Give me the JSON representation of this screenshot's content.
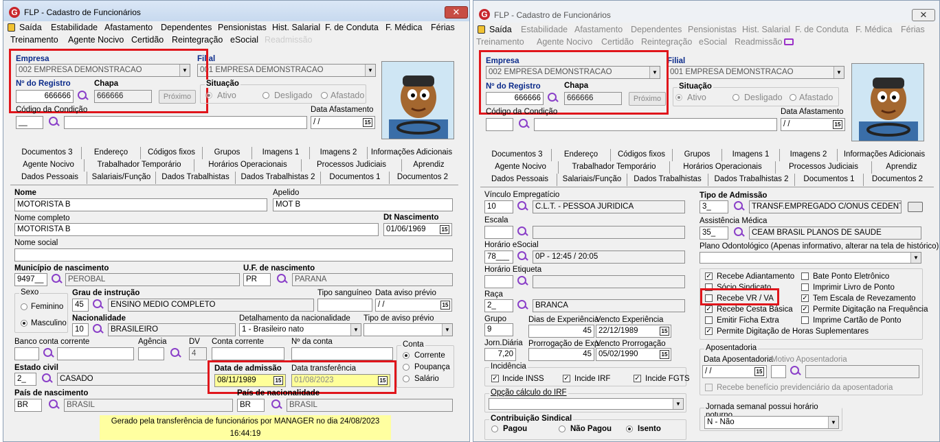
{
  "left": {
    "title": "FLP - Cadastro de Funcionários",
    "close": "✕",
    "menu1": [
      "Saída",
      "Estabilidade",
      "Afastamento",
      "Dependentes",
      "Pensionistas",
      "Hist. Salarial",
      "F. de Conduta",
      "F. Médica",
      "Férias"
    ],
    "menu2": [
      "Treinamento",
      "Agente Nocivo",
      "Certidão",
      "Reintegração",
      "eSocial",
      "Readmissão"
    ],
    "empresa_label": "Empresa",
    "empresa_value": "002 EMPRESA DEMONSTRACAO",
    "filial_label": "Filial",
    "filial_value": "001 EMPRESA DEMONSTRACAO",
    "nreg_label": "Nº do Registro",
    "nreg_value": "666666",
    "chapa_label": "Chapa",
    "chapa_value": "666666",
    "proximo": "Próximo",
    "situacao": "Situação",
    "ativo": "Ativo",
    "desligado": "Desligado",
    "afastado": "Afastado",
    "cond_label": "Código da Condição",
    "cond_value": "__",
    "dtafast_label": "Data Afastamento",
    "dtafast_value": " / /",
    "tabs1": [
      "Documentos 3",
      "Endereço",
      "Códigos fixos",
      "Grupos",
      "Imagens 1",
      "Imagens 2",
      "Informações Adicionais"
    ],
    "tabs2": [
      "Agente Nocivo",
      "Trabalhador Temporário",
      "Horários Operacionais",
      "Processos Judiciais",
      "Aprendiz"
    ],
    "tabs3": [
      "Dados Pessoais",
      "Salariais/Função",
      "Dados Trabalhistas",
      "Dados Trabalhistas 2",
      "Documentos 1",
      "Documentos 2"
    ],
    "nome_label": "Nome",
    "nome_value": "MOTORISTA B",
    "apelido_label": "Apelido",
    "apelido_value": "MOT B",
    "nomecomp_label": "Nome completo",
    "nomecomp_value": "MOTORISTA B",
    "dtnasc_label": "Dt Nascimento",
    "dtnasc_value": "01/06/1969",
    "nomesoc_label": "Nome social",
    "nomesoc_value": "",
    "munic_label": "Município de nascimento",
    "munic_code": "9497__",
    "munic_value": "PEROBAL",
    "uf_label": "U.F. de nascimento",
    "uf_code": "PR",
    "uf_value": "PARANA",
    "sexo": "Sexo",
    "feminino": "Feminino",
    "masculino": "Masculino",
    "grau_label": "Grau de instrução",
    "grau_code": "45",
    "grau_value": "ENSINO MEDIO COMPLETO",
    "sangue_label": "Tipo sanguíneo",
    "avisoprev_label": "Data aviso prévio",
    "avisoprev_value": " / /",
    "nac_label": "Nacionalidade",
    "nac_code": "10",
    "nac_value": "BRASILEIRO",
    "detnac_label": "Detalhamento da nacionalidade",
    "detnac_value": "1 - Brasileiro nato",
    "tipoaviso_label": "Tipo de aviso prévio",
    "banco_label": "Banco conta corrente",
    "agencia_label": "Agência",
    "dv_label": "DV",
    "dv_value": "4",
    "conta_label": "Conta corrente",
    "nconta_label": "Nº da conta",
    "contagrp": "Conta",
    "corrente": "Corrente",
    "poupanca": "Poupança",
    "salario": "Salário",
    "estciv_label": "Estado civil",
    "estciv_code": "2_",
    "estciv_value": "CASADO",
    "dtadm_label": "Data de admissão",
    "dtadm_value": "08/11/1989",
    "dttransf_label": "Data transferência",
    "dttransf_value": "01/08/2023",
    "pais_label": "País de nascimento",
    "pais_code": "BR",
    "pais_value": "BRASIL",
    "paisnac_label": "País de nacionalidade",
    "paisnac_code": "BR",
    "paisnac_value": "BRASIL",
    "note": "Gerado pela transferência de funcionários por MANAGER no dia 24/08/2023 16:44:19"
  },
  "right": {
    "title": "FLP - Cadastro de Funcionários",
    "close": "✕",
    "menu1": [
      "Saída",
      "Estabilidade",
      "Afastamento",
      "Dependentes",
      "Pensionistas",
      "Hist. Salarial",
      "F. de Conduta",
      "F. Médica",
      "Férias"
    ],
    "menu2": [
      "Treinamento",
      "Agente Nocivo",
      "Certidão",
      "Reintegração",
      "eSocial",
      "Readmissão"
    ],
    "empresa_label": "Empresa",
    "empresa_value": "002 EMPRESA DEMONSTRACAO",
    "filial_label": "Filial",
    "filial_value": "001 EMPRESA DEMONSTRACAO",
    "nreg_label": "Nº do Registro",
    "nreg_value": "666666",
    "chapa_label": "Chapa",
    "chapa_value": "666666",
    "proximo": "Próximo",
    "situacao": "Situação",
    "ativo": "Ativo",
    "desligado": "Desligado",
    "afastado": "Afastado",
    "cond_label": "Código da Condição",
    "dtafast_label": "Data Afastamento",
    "dtafast_value": " / /",
    "tabs1": [
      "Documentos 3",
      "Endereço",
      "Códigos fixos",
      "Grupos",
      "Imagens 1",
      "Imagens 2",
      "Informações Adicionais"
    ],
    "tabs2": [
      "Agente Nocivo",
      "Trabalhador Temporário",
      "Horários Operacionais",
      "Processos Judiciais",
      "Aprendiz"
    ],
    "tabs3": [
      "Dados Pessoais",
      "Salariais/Função",
      "Dados Trabalhistas",
      "Dados Trabalhistas 2",
      "Documentos 1",
      "Documentos 2"
    ],
    "vinc_label": "Vínculo Empregatício",
    "vinc_code": "10",
    "vinc_value": "C.L.T. - PESSOA JURIDICA",
    "escala_label": "Escala",
    "horario_label": "Horário eSocial",
    "horario_code": "78___",
    "horario_value": "0P - 12:45 / 20:05",
    "etiqueta_label": "Horário Etiqueta",
    "raca_label": "Raça",
    "raca_code": "2_",
    "raca_value": "BRANCA",
    "grupo_label": "Grupo",
    "grupo_value": "9",
    "diasexp_label": "Dias de Experiência",
    "diasexp_value": "45",
    "vencexp_label": "Vencto Experiência",
    "vencexp_value": "22/12/1989",
    "jorn_label": "Jorn.Diária",
    "jorn_value": "7,20",
    "prorrog_label": "Prorrogação de Exp.",
    "prorrog_value": "45",
    "vencprorrog_label": "Vencto Prorrogação",
    "vencprorrog_value": "05/02/1990",
    "incid_label": "Incidência",
    "inss": "Incide INSS",
    "irf": "Incide IRF",
    "fgts": "Incide FGTS",
    "opcirf_label": "Opção cálculo do IRF",
    "contsind_label": "Contribuição Sindical",
    "pagou": "Pagou",
    "naopagou": "Não Pagou",
    "isento": "Isento",
    "tipoadm_label": "Tipo de Admissão",
    "tipoadm_code": "3_",
    "tipoadm_value": "TRANSF.EMPREGADO C/ONUS CEDENT",
    "assist_label": "Assistência Médica",
    "assist_code": "35_",
    "assist_value": "CEAM BRASIL PLANOS DE SAUDE",
    "odonto_label": "Plano Odontológico (Apenas informativo, alterar na tela de histórico)",
    "chk_left": [
      "Recebe Adiantamento",
      "Sócio Sindicato",
      "Recebe VR / VA",
      "Recebe Cesta Básica",
      "Emitir Ficha Extra",
      "Permite Digitação de Horas Suplementares"
    ],
    "chk_right": [
      "Bate Ponto Eletrônico",
      "Imprimir Livro de Ponto",
      "Tem Escala de Revezamento",
      "Permite Digitação na Frequência",
      "Imprime Cartão de Ponto"
    ],
    "apos_label": "Aposentadoria",
    "dtapos_label": "Data Aposentadoria",
    "motapos_label": "Motivo Aposentadoria",
    "dtapos_value": " / /",
    "benef_label": "Recebe benefício previdenciário da aposentadoria",
    "jornada_label": "Jornada semanal possui horário noturno",
    "jornada_value": "N - Não"
  }
}
